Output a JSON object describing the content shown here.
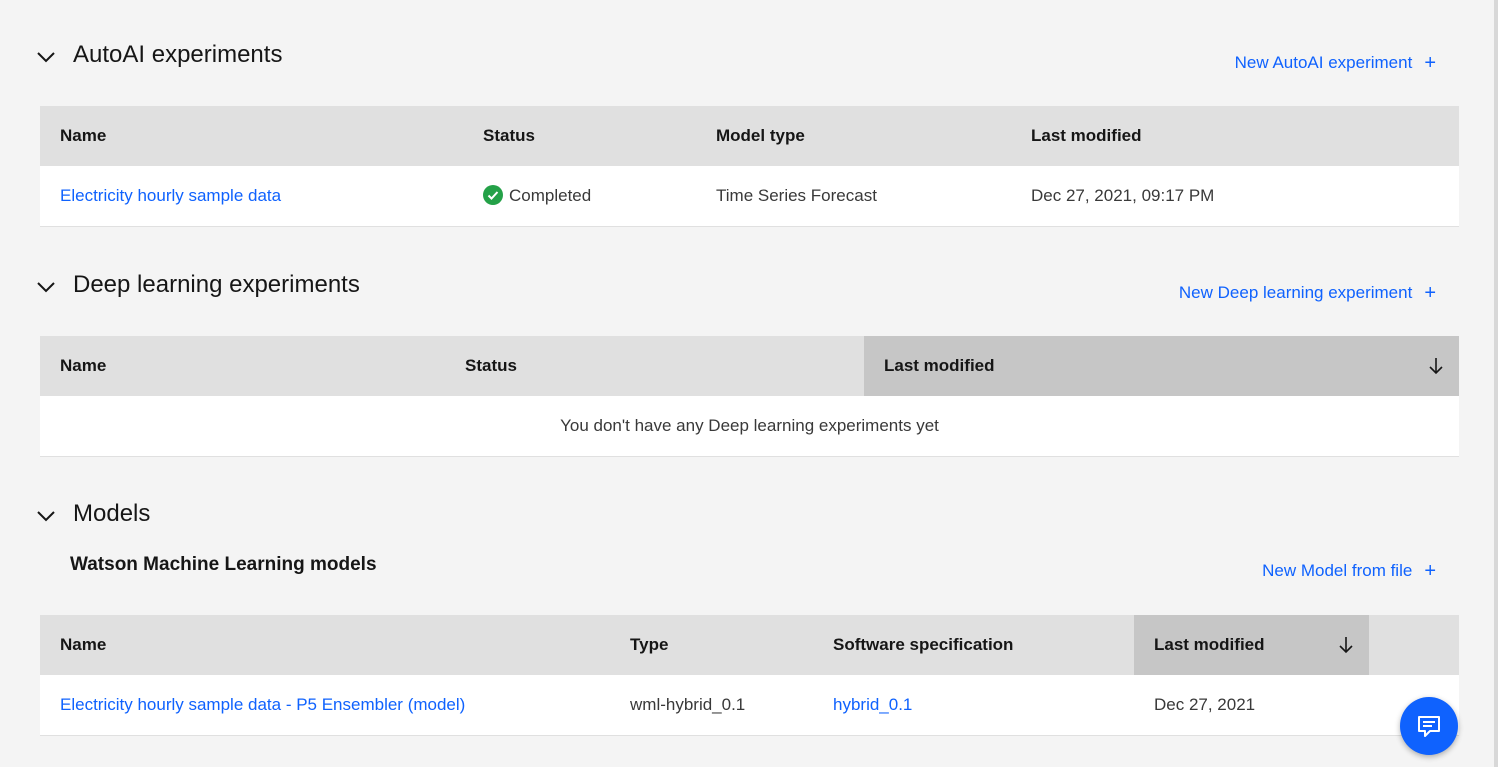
{
  "autoai": {
    "title": "AutoAI experiments",
    "new_link": "New AutoAI experiment",
    "columns": [
      "Name",
      "Status",
      "Model type",
      "Last modified"
    ],
    "rows": [
      {
        "name": "Electricity hourly sample data",
        "status": "Completed",
        "model_type": "Time Series Forecast",
        "last_modified": "Dec 27, 2021, 09:17 PM"
      }
    ]
  },
  "deep_learning": {
    "title": "Deep learning experiments",
    "new_link": "New Deep learning experiment",
    "columns": [
      "Name",
      "Status",
      "Last modified"
    ],
    "sorted_column": "Last modified",
    "empty_message": "You don't have any Deep learning experiments yet"
  },
  "models": {
    "title": "Models",
    "subheading": "Watson Machine Learning models",
    "new_link": "New Model from file",
    "columns": [
      "Name",
      "Type",
      "Software specification",
      "Last modified"
    ],
    "sorted_column": "Last modified",
    "rows": [
      {
        "name": "Electricity hourly sample data - P5 Ensembler (model)",
        "type": "wml-hybrid_0.1",
        "software_spec": "hybrid_0.1",
        "last_modified": "Dec 27, 2021"
      }
    ]
  },
  "icons": {
    "chevron": "chevron-down-icon",
    "plus": "+",
    "sort": "arrow-down-icon",
    "status": "checkmark-filled-icon",
    "chat": "chat-icon"
  },
  "colors": {
    "link": "#0f62fe",
    "status_success": "#24a148",
    "header_bg": "#e0e0e0",
    "sorted_header_bg": "#c6c6c6",
    "page_bg": "#f4f4f4"
  }
}
